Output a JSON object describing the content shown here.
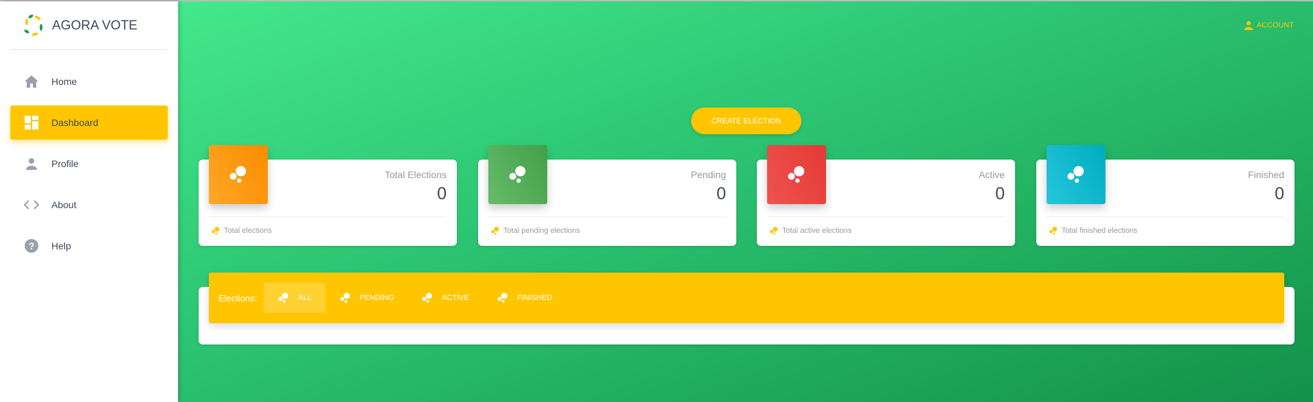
{
  "sidebar": {
    "brand": "AGORA VOTE",
    "items": [
      {
        "label": "Home",
        "icon": "home-icon"
      },
      {
        "label": "Dashboard",
        "icon": "dashboard-icon",
        "active": true
      },
      {
        "label": "Profile",
        "icon": "person-icon"
      },
      {
        "label": "About",
        "icon": "code-icon"
      },
      {
        "label": "Help",
        "icon": "help-icon"
      }
    ]
  },
  "header": {
    "account_label": "ACCOUNT"
  },
  "main": {
    "create_label": "CREATE ELECTION",
    "cards": [
      {
        "title": "Total Elections",
        "value": "0",
        "footer": "Total elections",
        "color": "#ff8a00"
      },
      {
        "title": "Pending",
        "value": "0",
        "footer": "Total pending elections",
        "color": "#43a047"
      },
      {
        "title": "Active",
        "value": "0",
        "footer": "Total active elections",
        "color": "#e53935"
      },
      {
        "title": "Finished",
        "value": "0",
        "footer": "Total finished elections",
        "color": "#00acc1"
      }
    ],
    "tabs_label": "Elections:",
    "tabs": [
      {
        "label": "ALL",
        "active": true
      },
      {
        "label": "PENDING"
      },
      {
        "label": "ACTIVE"
      },
      {
        "label": "FINISHED"
      }
    ]
  },
  "colors": {
    "accent": "#ffc600",
    "background_start": "#45e88b",
    "background_end": "#13914a"
  }
}
